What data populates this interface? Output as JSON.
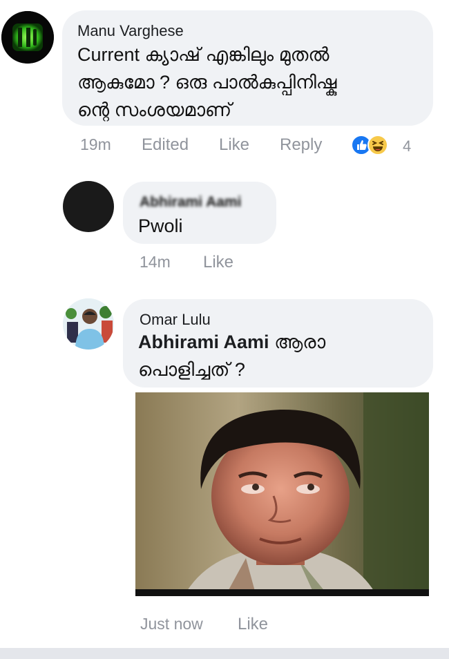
{
  "comments": [
    {
      "author": "Manu Varghese",
      "text_line1": "Current ക്യാഷ് എങ്കിലും മുതൽ",
      "text_line2": "ആകുമോ ? ഒരു പാൽകുപ്പിനിഷ്കു",
      "text_line3": "ന്റെ സംശയമാണ്",
      "time": "19m",
      "edited": "Edited",
      "like": "Like",
      "reply": "Reply",
      "reaction_count": "4",
      "reactions": [
        "like-reaction-icon",
        "haha-reaction-icon"
      ],
      "avatar_icon": "logo-avatar-icon"
    },
    {
      "author": "Abhirami Aami",
      "text": "Pwoli",
      "time": "14m",
      "like": "Like"
    },
    {
      "author": "Omar Lulu",
      "mention": "Abhirami Aami",
      "text_after_mention": "ആരാ",
      "text_line2": "പൊളിച്ചത് ?",
      "time": "Just now",
      "like": "Like",
      "attachment": "meme-image"
    }
  ],
  "colors": {
    "bubble": "#f0f2f5",
    "meta_text": "#90949c",
    "like_blue": "#1877f2",
    "haha_yellow": "#f7c94a"
  }
}
